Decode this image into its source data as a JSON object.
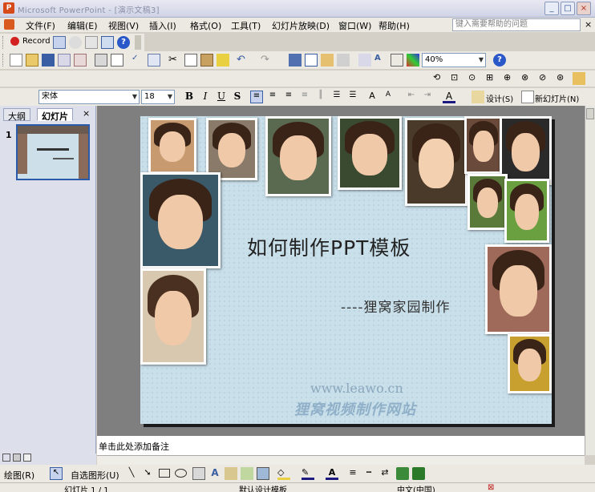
{
  "window": {
    "title": "Microsoft PowerPoint - [演示文稿3]"
  },
  "menu": {
    "items": [
      "文件(F)",
      "编辑(E)",
      "视图(V)",
      "插入(I)",
      "格式(O)",
      "工具(T)",
      "幻灯片放映(D)",
      "窗口(W)",
      "帮助(H)"
    ],
    "help_placeholder": "键入需要帮助的问题"
  },
  "toolbar": {
    "record_label": "Record",
    "zoom_value": "40%",
    "font_name": "宋体",
    "font_size": "18",
    "bold": "B",
    "italic": "I",
    "underline": "U",
    "shadow": "S",
    "design_label": "设计(S)",
    "new_slide_label": "新幻灯片(N)"
  },
  "panel": {
    "tabs": [
      "大纲",
      "幻灯片"
    ],
    "close": "×",
    "slide_number": "1"
  },
  "slide": {
    "title": "如何制作PPT模板",
    "subtitle": "----狸窝家园制作",
    "url": "www.leawo.cn",
    "watermark": "狸窝视频制作网站"
  },
  "notes": {
    "placeholder": "单击此处添加备注"
  },
  "drawing": {
    "draw_label": "绘图(R)",
    "autoshapes_label": "自选图形(U)"
  },
  "status": {
    "slide_info": "幻灯片 1 / 1",
    "design_name": "默认设计模板",
    "language": "中文(中国)"
  },
  "colors": {
    "slide_bg": "#c9dfea",
    "office_accent": "#d64a1a",
    "selection_border": "#2b5ba8"
  }
}
